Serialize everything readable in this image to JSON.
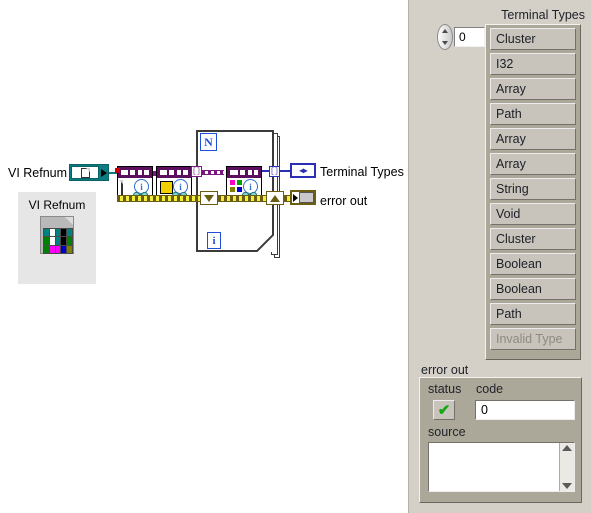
{
  "block_diagram": {
    "refnum_control_label": "VI Refnum",
    "vi_icon_caption": "VI Refnum",
    "loop_count_terminal": "N",
    "loop_index_terminal": "i",
    "tunnel_glyph": "[]",
    "output_terminals": [
      {
        "label": "Terminal Types",
        "glyph": "◀▶",
        "color": "#2b2fb5"
      },
      {
        "label": "error out",
        "glyph": "",
        "color": "#6b5e12"
      }
    ],
    "icon_names": [
      "document-icon",
      "info-icon",
      "spectacles-icon",
      "vi-icon"
    ]
  },
  "front_panel": {
    "array": {
      "title": "Terminal Types",
      "index_value": "0",
      "spinner_up": "increment-index",
      "spinner_down": "decrement-index",
      "items": [
        {
          "text": "Cluster",
          "disabled": false
        },
        {
          "text": "I32",
          "disabled": false
        },
        {
          "text": "Array",
          "disabled": false
        },
        {
          "text": "Path",
          "disabled": false
        },
        {
          "text": "Array",
          "disabled": false
        },
        {
          "text": "Array",
          "disabled": false
        },
        {
          "text": "String",
          "disabled": false
        },
        {
          "text": "Void",
          "disabled": false
        },
        {
          "text": "Cluster",
          "disabled": false
        },
        {
          "text": "Boolean",
          "disabled": false
        },
        {
          "text": "Boolean",
          "disabled": false
        },
        {
          "text": "Path",
          "disabled": false
        },
        {
          "text": "Invalid Type",
          "disabled": true
        }
      ]
    },
    "error_out": {
      "title": "error out",
      "status_label": "status",
      "status_value": "✔",
      "status_color": "#14a814",
      "code_label": "code",
      "code_value": "0",
      "source_label": "source",
      "source_value": ""
    }
  },
  "colors": {
    "panel_background": "#d4d0c8",
    "diagram_background": "#ffffff",
    "refnum_teal": "#0d7c80",
    "node_header_purple": "#5b0f5e",
    "error_wire_olive": "#6b5e12",
    "array_wire_blue": "#2b2fb5"
  }
}
